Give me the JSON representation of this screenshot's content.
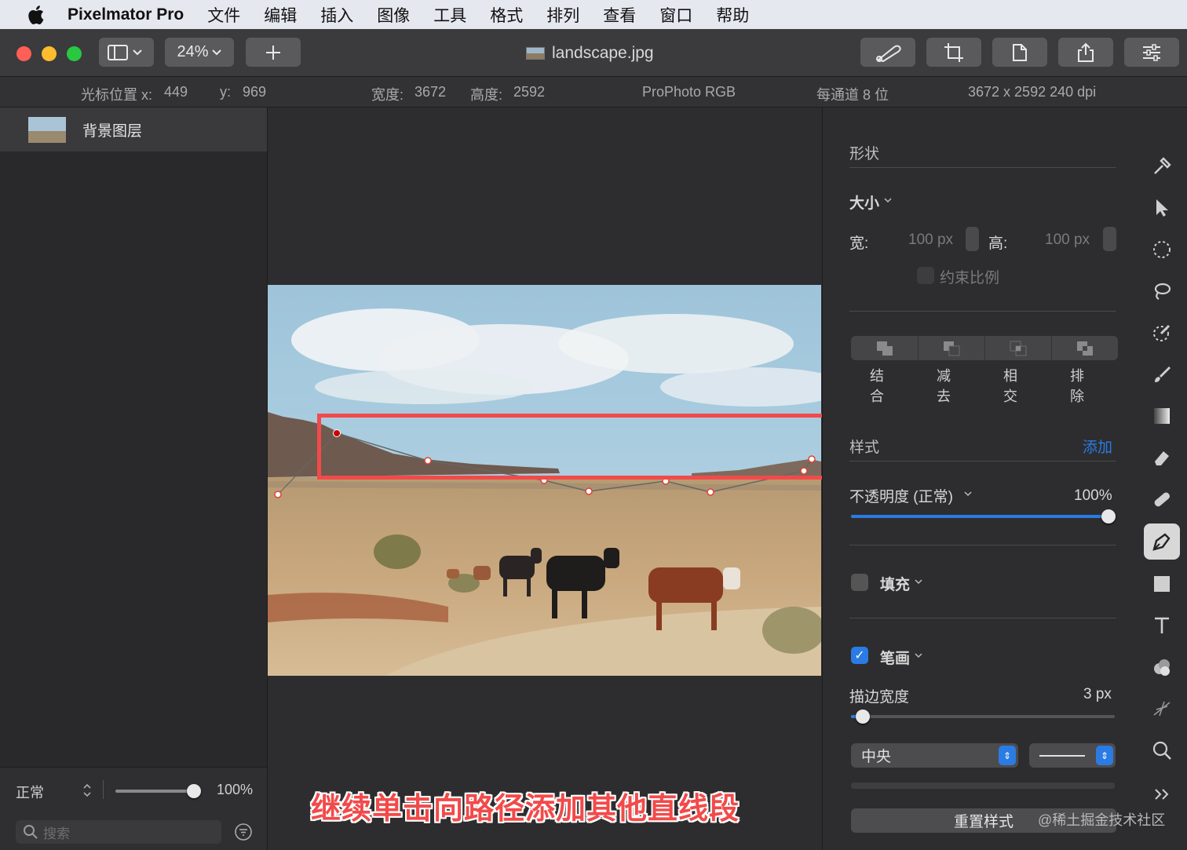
{
  "menubar": {
    "app_name": "Pixelmator Pro",
    "items": [
      "文件",
      "编辑",
      "插入",
      "图像",
      "工具",
      "格式",
      "排列",
      "查看",
      "窗口",
      "帮助"
    ]
  },
  "toolbar": {
    "zoom": "24%",
    "document_title": "landscape.jpg"
  },
  "infobar": {
    "cursor_x_label": "光标位置 x:",
    "cursor_x": "449",
    "cursor_y_label": "y:",
    "cursor_y": "969",
    "width_label": "宽度:",
    "width": "3672",
    "height_label": "高度:",
    "height": "2592",
    "color_profile": "ProPhoto RGB",
    "bit_depth": "每通道 8 位",
    "dimensions_dpi": "3672 x 2592 240 dpi"
  },
  "layers": {
    "items": [
      {
        "name": "背景图层"
      }
    ],
    "blend_mode": "正常",
    "opacity": "100%",
    "search_placeholder": "搜索"
  },
  "canvas": {
    "caption": "继续单击向路径添加其他直线段"
  },
  "inspector": {
    "shape_header": "形状",
    "size_label": "大小",
    "width_label": "宽:",
    "width_value": "100 px",
    "height_label": "高:",
    "height_value": "100 px",
    "constrain_label": "约束比例",
    "boolean_ops": [
      "结合",
      "减去",
      "相交",
      "排除"
    ],
    "style_header": "样式",
    "add_label": "添加",
    "opacity_label": "不透明度 (正常)",
    "opacity_value": "100%",
    "opacity_fraction": 1.0,
    "fill_label": "填充",
    "fill_checked": false,
    "stroke_label": "笔画",
    "stroke_checked": true,
    "stroke_width_label": "描边宽度",
    "stroke_width_value": "3 px",
    "stroke_position": "中央",
    "reset_style_label": "重置样式"
  },
  "watermark": "@稀土掘金技术社区",
  "colors": {
    "accent": "#2a7be4",
    "highlight_red": "#f24a4a"
  }
}
